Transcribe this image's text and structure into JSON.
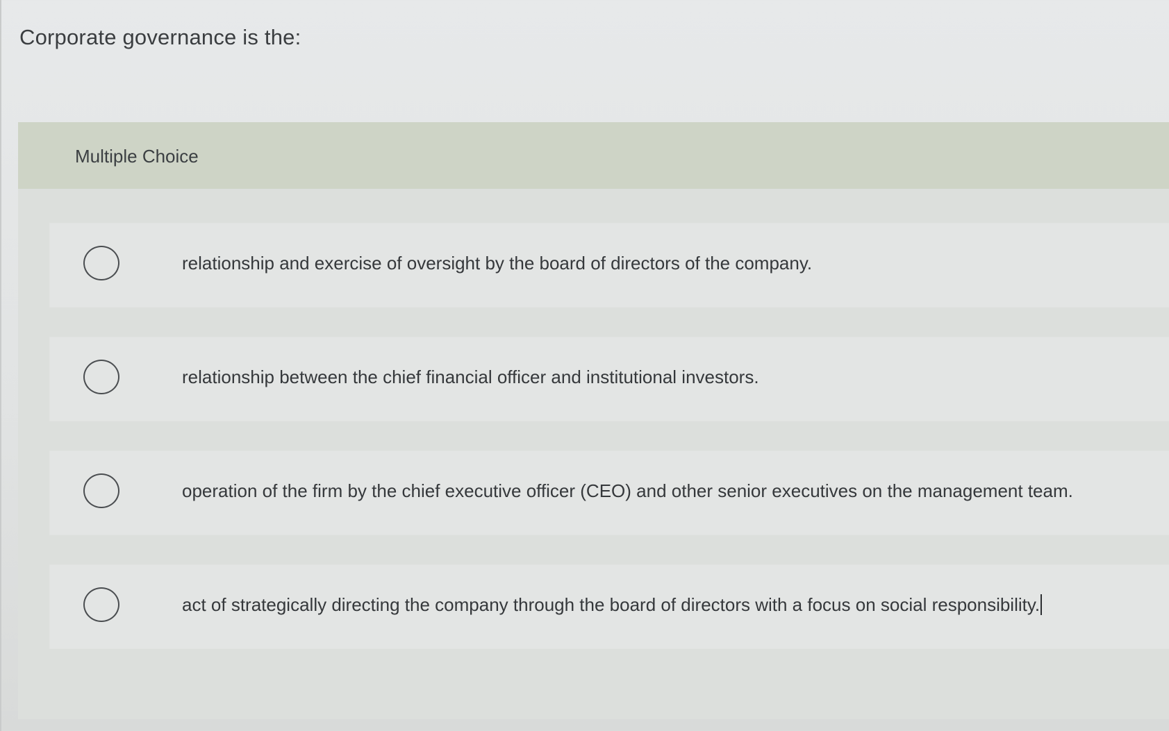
{
  "question": {
    "text": "Corporate governance is the:"
  },
  "multiple_choice": {
    "header_label": "Multiple Choice",
    "options": [
      {
        "label": "relationship and exercise of oversight by the board of directors of the company."
      },
      {
        "label": "relationship between the chief financial officer and institutional investors."
      },
      {
        "label": "operation of the firm by the chief executive officer (CEO) and other senior executives on the management team."
      },
      {
        "label": "act of strategically directing the company through the board of directors with a focus on social responsibility."
      }
    ]
  }
}
